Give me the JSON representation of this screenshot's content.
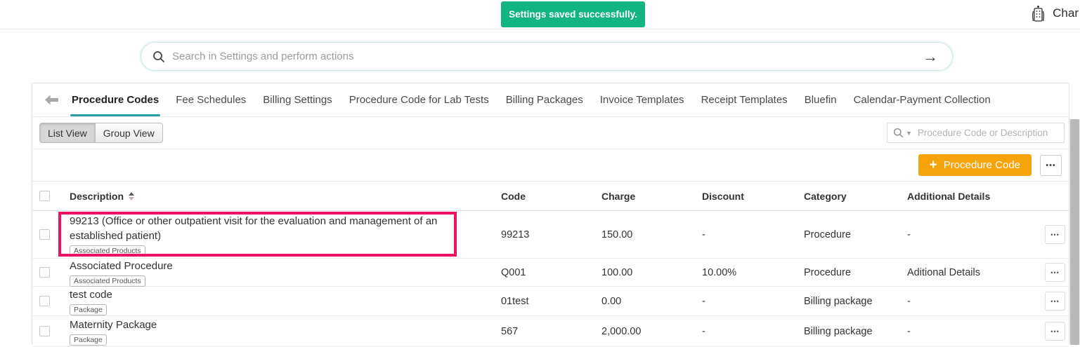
{
  "topbar": {
    "toast_message": "Settings saved successfully.",
    "brand_label": "Char"
  },
  "global_search": {
    "placeholder": "Search in Settings and perform actions",
    "submit_arrow": "→"
  },
  "tabs": [
    {
      "label": "Procedure Codes",
      "active": true
    },
    {
      "label": "Fee Schedules",
      "active": false
    },
    {
      "label": "Billing Settings",
      "active": false
    },
    {
      "label": "Procedure Code for Lab Tests",
      "active": false
    },
    {
      "label": "Billing Packages",
      "active": false
    },
    {
      "label": "Invoice Templates",
      "active": false
    },
    {
      "label": "Receipt Templates",
      "active": false
    },
    {
      "label": "Bluefin",
      "active": false
    },
    {
      "label": "Calendar-Payment Collection",
      "active": false
    }
  ],
  "toolbar": {
    "list_view_label": "List View",
    "group_view_label": "Group View",
    "selected_view": "List View",
    "filter_search_placeholder": "Procedure Code or Description",
    "add_icon": "+",
    "add_procedure_label": "Procedure Code",
    "more_label": "•••"
  },
  "table": {
    "headers": {
      "description": "Description",
      "code": "Code",
      "charge": "Charge",
      "discount": "Discount",
      "category": "Category",
      "additional_details": "Additional Details"
    },
    "sorted_by": "Description",
    "sort_direction": "ascending",
    "row_action_label": "•••",
    "rows": [
      {
        "description": "99213 (Office or other outpatient visit for the evaluation and management of an established patient)",
        "badge": "Associated Products",
        "code": "99213",
        "charge": "150.00",
        "discount": "-",
        "category": "Procedure",
        "additional_details": "-",
        "highlighted": true
      },
      {
        "description": "Associated Procedure",
        "badge": "Associated Products",
        "code": "Q001",
        "charge": "100.00",
        "discount": "10.00%",
        "category": "Procedure",
        "additional_details": "Aditional Details",
        "highlighted": false
      },
      {
        "description": "test code",
        "badge": "Package",
        "code": "01test",
        "charge": "0.00",
        "discount": "-",
        "category": "Billing package",
        "additional_details": "-",
        "highlighted": false
      },
      {
        "description": "Maternity Package",
        "badge": "Package",
        "code": "567",
        "charge": "2,000.00",
        "discount": "-",
        "category": "Billing package",
        "additional_details": "-",
        "highlighted": false
      }
    ]
  },
  "colors": {
    "toast_green": "#12b482",
    "accent_teal": "#2a9d9d",
    "button_orange": "#f7a30b",
    "highlight_pink": "#ed1164"
  }
}
